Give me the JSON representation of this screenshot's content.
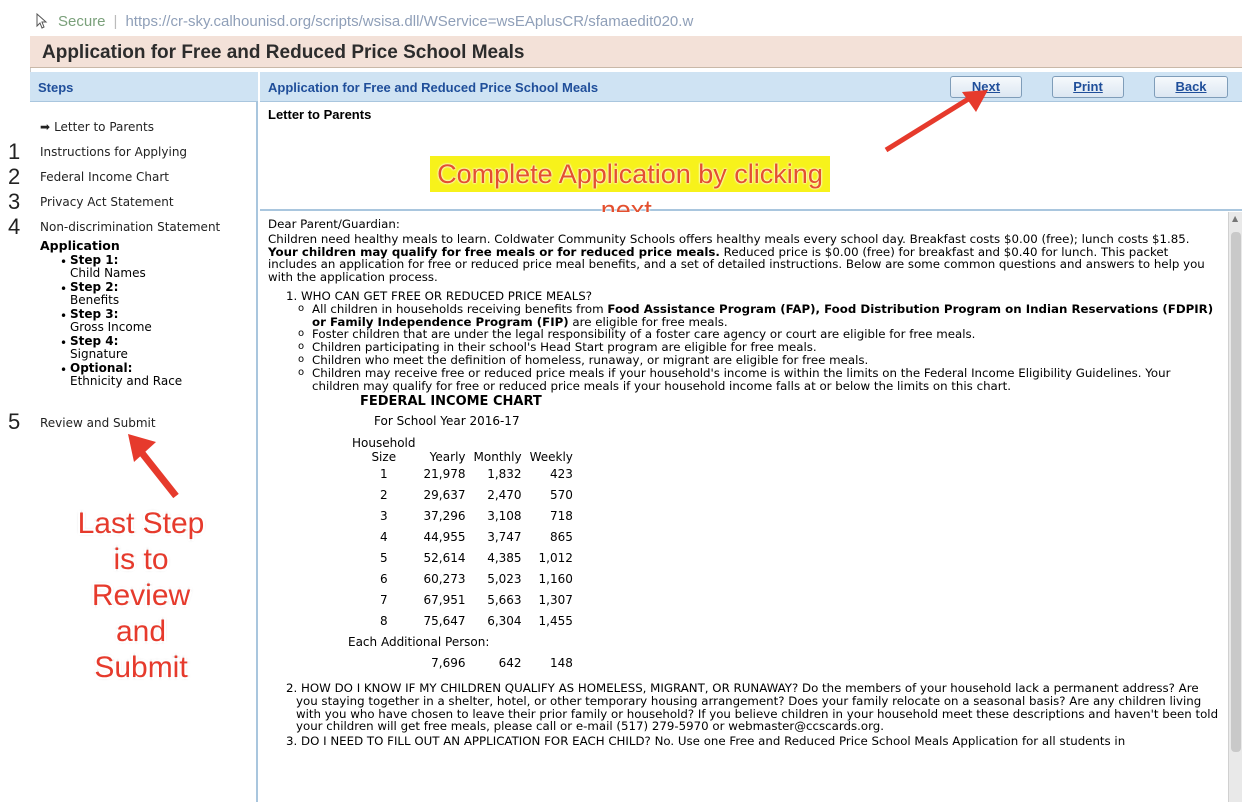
{
  "browser": {
    "secure_label": "Secure",
    "url": "https://cr-sky.calhounisd.org/scripts/wsisa.dll/WService=wsEAplusCR/sfamaedit020.w"
  },
  "page_title": "Application for Free and Reduced Price School Meals",
  "steps_header": "Steps",
  "main_header": {
    "title": "Application for Free and Reduced Price School Meals",
    "next_label": "Next",
    "print_label": "Print",
    "back_label": "Back"
  },
  "sidebar": {
    "letter": "Letter to Parents",
    "instructions": "Instructions for Applying",
    "federal": "Federal Income Chart",
    "privacy": "Privacy Act Statement",
    "nondiscrimination": "Non-discrimination Statement",
    "application": "Application",
    "step1_title": "Step 1:",
    "step1_sub": "Child Names",
    "step2_title": "Step 2:",
    "step2_sub": "Benefits",
    "step3_title": "Step 3:",
    "step3_sub": "Gross Income",
    "step4_title": "Step 4:",
    "step4_sub": "Signature",
    "optional_title": "Optional:",
    "optional_sub": "Ethnicity and Race",
    "review": "Review and Submit"
  },
  "annotations": {
    "n1": "1",
    "n2": "2",
    "n3": "3",
    "n4": "4",
    "n5": "5",
    "callout": "Complete Application by clicking next.",
    "last_step": "Last Step is to Review and Submit",
    "accent": "#e63a2c",
    "highlight": "#f7f21b"
  },
  "letter_header": "Letter to Parents",
  "letter": {
    "greeting": "Dear Parent/Guardian:",
    "intro_a": "Children need healthy meals to learn. Coldwater Community Schools offers healthy meals every school day. Breakfast costs $0.00 (free); lunch costs $1.85.",
    "intro_bold": "Your children may qualify for free meals or for reduced price meals.",
    "intro_b": "Reduced price is $0.00 (free) for breakfast and $0.40 for lunch. This packet includes an application for free or reduced price meal benefits, and a set of detailed instructions. Below are some common questions and answers to help you with the application process.",
    "q1": "1. WHO CAN GET FREE OR REDUCED PRICE MEALS?",
    "q1_b1_a": "All children in households receiving benefits from",
    "q1_b1_bold": "Food Assistance Program (FAP), Food Distribution Program on Indian Reservations (FDPIR) or Family Independence Program (FIP)",
    "q1_b1_b": "are eligible for free meals.",
    "q1_b2": "Foster children that are under the legal responsibility of a foster care agency or court are eligible for free meals.",
    "q1_b3": "Children participating in their school's Head Start program are eligible for free meals.",
    "q1_b4": "Children who meet the definition of homeless, runaway, or migrant are eligible for free meals.",
    "q1_b5": "Children may receive free or reduced price meals if your household's income is within the limits on the Federal Income Eligibility Guidelines. Your children may qualify for free or reduced price meals if your household income falls at or below the limits on this chart.",
    "q2": "2. HOW DO I KNOW IF MY CHILDREN QUALIFY AS HOMELESS, MIGRANT, OR RUNAWAY? Do the members of your household lack a permanent address? Are you staying together in a shelter, hotel, or other temporary housing arrangement? Does your family relocate on a seasonal basis? Are any children living with you who have chosen to leave their prior family or household? If you believe children in your household meet these descriptions and haven't been told your children will get free meals, please call or e-mail (517) 279-5970 or webmaster@ccscards.org.",
    "q3": "3. DO I NEED TO FILL OUT AN APPLICATION FOR EACH CHILD? No. Use one Free and Reduced Price School Meals Application for all students in"
  },
  "income_chart": {
    "title": "FEDERAL INCOME CHART",
    "subtitle": "For School Year 2016-17",
    "col_household": "Household",
    "col_size": "Size",
    "col_yearly": "Yearly",
    "col_monthly": "Monthly",
    "col_weekly": "Weekly",
    "rows": [
      [
        "1",
        "21,978",
        "1,832",
        "423"
      ],
      [
        "2",
        "29,637",
        "2,470",
        "570"
      ],
      [
        "3",
        "37,296",
        "3,108",
        "718"
      ],
      [
        "4",
        "44,955",
        "3,747",
        "865"
      ],
      [
        "5",
        "52,614",
        "4,385",
        "1,012"
      ],
      [
        "6",
        "60,273",
        "5,023",
        "1,160"
      ],
      [
        "7",
        "67,951",
        "5,663",
        "1,307"
      ],
      [
        "8",
        "75,647",
        "6,304",
        "1,455"
      ]
    ],
    "additional_label": "Each Additional Person:",
    "additional": [
      "7,696",
      "642",
      "148"
    ]
  }
}
